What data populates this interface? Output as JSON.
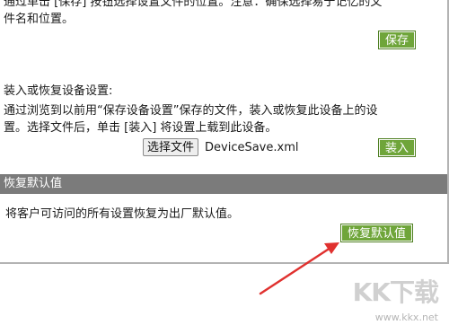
{
  "save_section": {
    "description_line1": "通过单击 [保存] 按钮选择设置文件的位置。注意：确保选择易于记忆的文",
    "description_line2": "件名和位置。",
    "save_button": "保存"
  },
  "load_section": {
    "heading": "装入或恢复设备设置:",
    "description_line1": "通过浏览到以前用“保存设备设置”保存的文件，装入或恢复此设备上的设",
    "description_line2": "置。选择文件后，单击 [装入] 将设置上载到此设备。",
    "choose_file_button": "选择文件",
    "file_name": "DeviceSave.xml",
    "load_button": "装入"
  },
  "restore_section": {
    "header": "恢复默认值",
    "description": "将客户可访问的所有设置恢复为出厂默认值。",
    "restore_button": "恢复默认值"
  },
  "annotation": {
    "arrow_color": "#e0312f"
  },
  "watermark": {
    "logo": "KK下载",
    "url": "www.kkx.net"
  }
}
